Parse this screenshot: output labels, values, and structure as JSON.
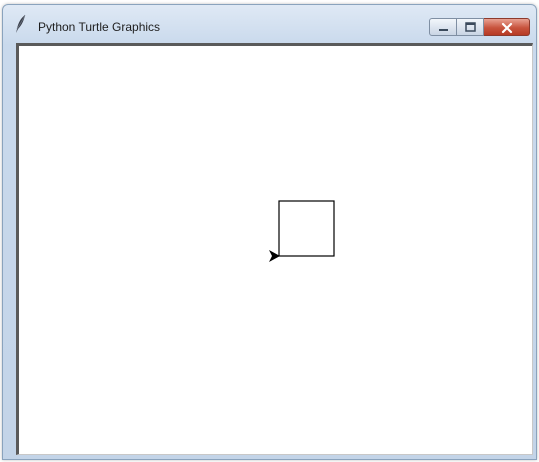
{
  "window": {
    "title": "Python Turtle Graphics",
    "icon": "feather-icon"
  },
  "controls": {
    "minimize_icon": "minimize-icon",
    "maximize_icon": "maximize-icon",
    "close_icon": "close-icon"
  },
  "canvas": {
    "background": "#ffffff",
    "pen_color": "#000000",
    "turtle_shape": "classic-arrow",
    "turtle_heading": "east"
  }
}
